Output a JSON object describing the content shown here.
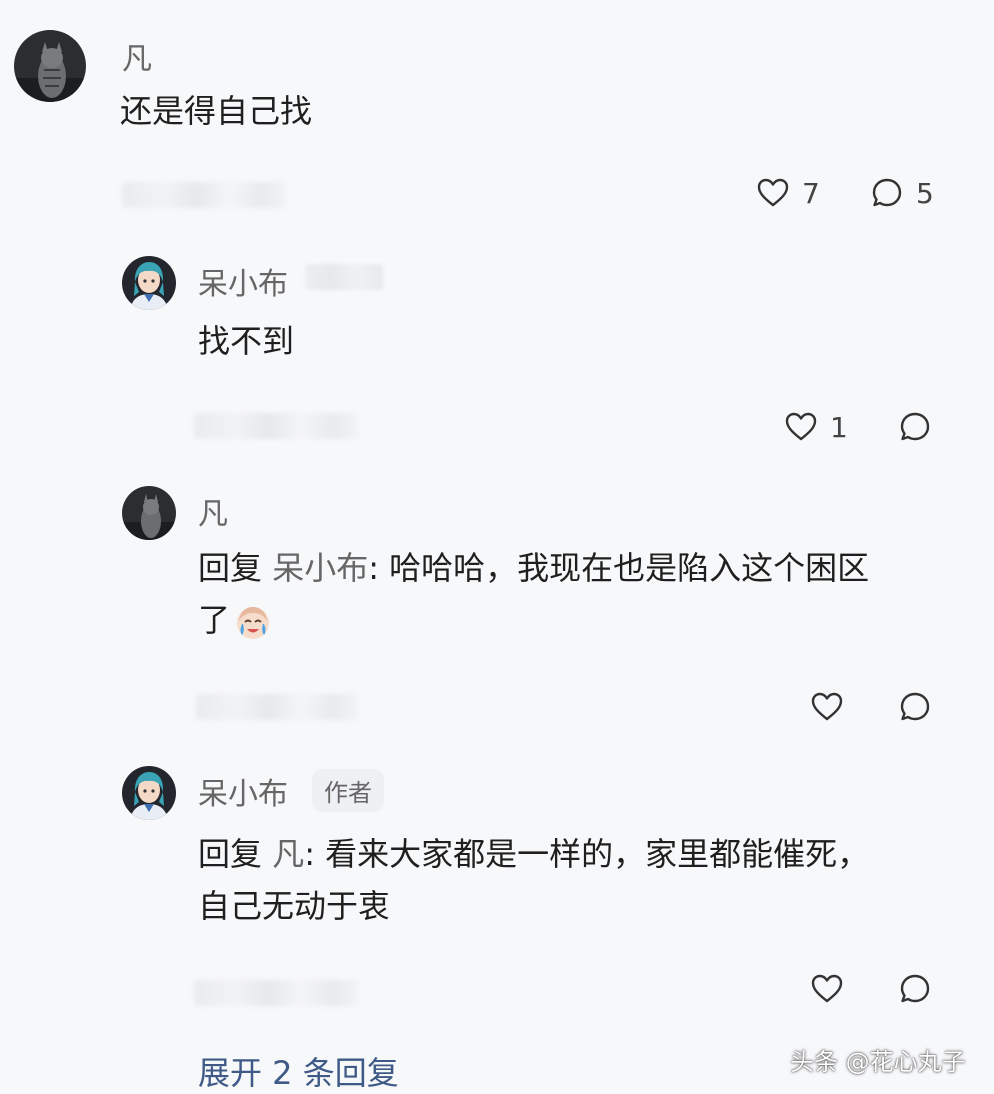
{
  "comments": [
    {
      "user": "凡",
      "text": "还是得自己找",
      "like_count": "7",
      "reply_count": "5"
    },
    {
      "user": "呆小布",
      "text": "找不到",
      "like_count": "1"
    },
    {
      "user": "凡",
      "reply_prefix": "回复",
      "reply_target": "呆小布",
      "text_line1": ": 哈哈哈，我现在也是陷入这个困区",
      "text_line2": "了"
    },
    {
      "user": "呆小布",
      "badge": "作者",
      "reply_prefix": "回复",
      "reply_target": "凡",
      "text_line1": ": 看来大家都是一样的，家里都能催死，",
      "text_line2": "自己无动于衷"
    }
  ],
  "expand_label": "展开 2 条回复",
  "watermark": "头条 @花心丸子",
  "colors": {
    "background": "#f7f8fa",
    "link": "#3f5a86",
    "muted": "#666666"
  },
  "icons": [
    "heart-icon",
    "comment-icon",
    "crying-emoji"
  ]
}
